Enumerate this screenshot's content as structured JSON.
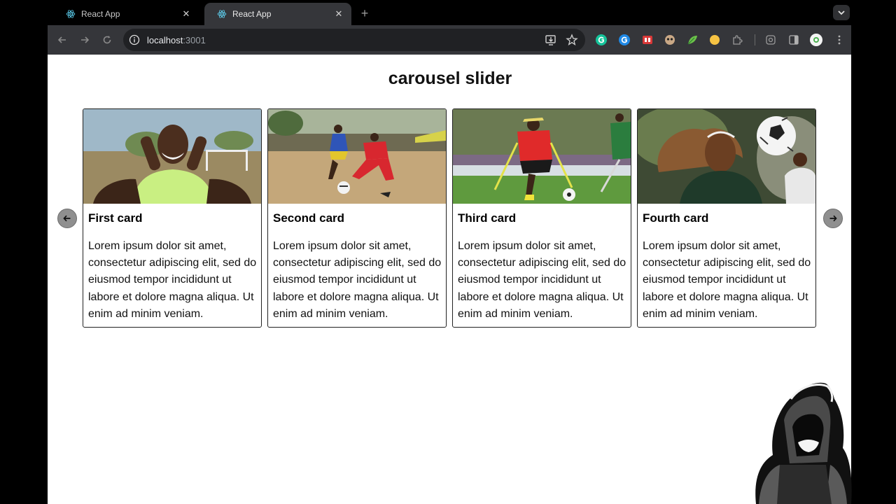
{
  "browser": {
    "tabs": [
      {
        "title": "React App",
        "active": false
      },
      {
        "title": "React App",
        "active": true
      }
    ],
    "url": {
      "host": "localhost",
      "port": ":3001"
    }
  },
  "page": {
    "title": "carousel slider",
    "cards": [
      {
        "heading": "First card",
        "text": "Lorem ipsum dolor sit amet, consectetur adipiscing elit, sed do eiusmod tempor incididunt ut labore et dolore magna aliqua. Ut enim ad minim veniam."
      },
      {
        "heading": "Second card",
        "text": "Lorem ipsum dolor sit amet, consectetur adipiscing elit, sed do eiusmod tempor incididunt ut labore et dolore magna aliqua. Ut enim ad minim veniam."
      },
      {
        "heading": "Third card",
        "text": "Lorem ipsum dolor sit amet, consectetur adipiscing elit, sed do eiusmod tempor incididunt ut labore et dolore magna aliqua. Ut enim ad minim veniam."
      },
      {
        "heading": "Fourth card",
        "text": "Lorem ipsum dolor sit amet, consectetur adipiscing elit, sed do eiusmod tempor incididunt ut labore et dolore magna aliqua. Ut enim ad minim veniam."
      }
    ],
    "arrows": {
      "prev": "arrow-left-icon",
      "next": "arrow-right-icon"
    }
  },
  "colors": {
    "chrome_bg": "#35363a",
    "omnibox_bg": "#202124",
    "arrow_btn": "#8f8f8f"
  }
}
